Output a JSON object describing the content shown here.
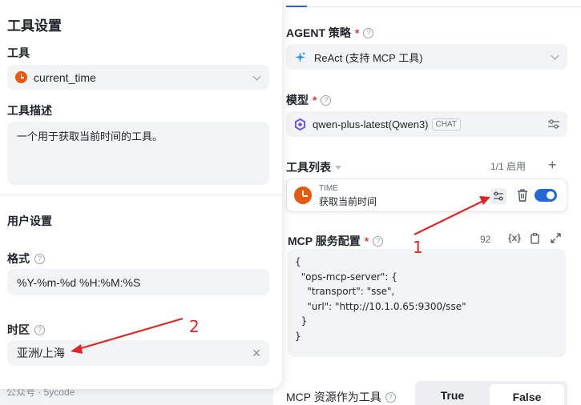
{
  "left_panel": {
    "title": "工具设置",
    "tool_label": "工具",
    "tool_value": "current_time",
    "desc_label": "工具描述",
    "desc_value": "一个用于获取当前时间的工具。",
    "user_settings_label": "用户设置",
    "format_label": "格式",
    "format_value": "%Y-%m-%d %H:%M:%S",
    "timezone_label": "时区",
    "timezone_value": "亚洲/上海",
    "help_glyph": "?",
    "clear_glyph": "✕"
  },
  "footer": {
    "watermark": "公众号 · 5ycode"
  },
  "right_panel": {
    "strategy_label": "AGENT 策略",
    "required_mark": "*",
    "strategy_value": "ReAct (支持 MCP 工具)",
    "model_label": "模型",
    "model_value": "qwen-plus-latest(Qwen3)",
    "model_badge": "CHAT",
    "toollist_label": "工具列表",
    "enabled_count": "1/1 启用",
    "add_glyph": "+",
    "tool_card": {
      "name": "TIME",
      "description": "获取当前时间",
      "enabled": true
    },
    "mcp_label": "MCP 服务配置",
    "mcp_char_count": "92",
    "mcp_var_glyph": "{x}",
    "mcp_code": "{\n  \"ops-mcp-server\": {\n    \"transport\": \"sse\",\n    \"url\": \"http://10.1.0.65:9300/sse\"\n  }\n}",
    "mcp_resource_label": "MCP 资源作为工具",
    "bool_true": "True",
    "bool_false": "False",
    "bool_selected": "False"
  },
  "annotations": {
    "label_1": "1",
    "label_2": "2",
    "color": "#e02424"
  },
  "icons": {
    "tool_icon": "clock-icon",
    "strategy_icon": "sparkle-icon",
    "model_icon": "qwen-logo-icon"
  }
}
